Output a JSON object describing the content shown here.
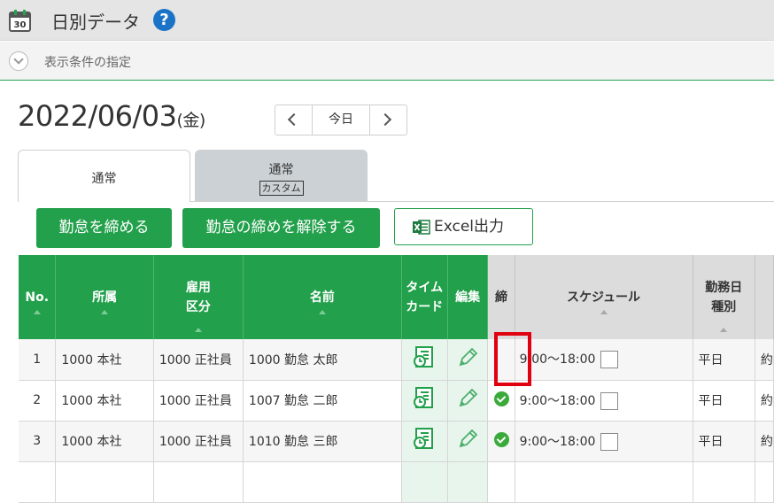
{
  "header": {
    "title": "日別データ",
    "calendar_day": "30",
    "help_symbol": "?"
  },
  "conditions": {
    "label": "表示条件の指定"
  },
  "date_nav": {
    "date": "2022/06/03",
    "weekday": "(金)",
    "today_label": "今日"
  },
  "tabs": [
    {
      "label": "通常",
      "sub": ""
    },
    {
      "label": "通常",
      "sub": "カスタム"
    }
  ],
  "actions": {
    "close_label": "勤怠を締める",
    "unclose_label": "勤怠の締めを解除する",
    "excel_label": "Excel出力"
  },
  "table": {
    "headers": {
      "no": "No.",
      "dept": "所属",
      "emp_type_1": "雇用",
      "emp_type_2": "区分",
      "name": "名前",
      "timecard_1": "タイム",
      "timecard_2": "カード",
      "edit": "編集",
      "close": "締",
      "schedule": "スケジュール",
      "daytype_1": "勤務日",
      "daytype_2": "種別"
    },
    "rows": [
      {
        "no": "1",
        "dept": "1000 本社",
        "emp_type": "1000 正社員",
        "name": "1000 勤怠 太郎",
        "closed": false,
        "schedule": "9:00～18:00",
        "day_type": "平日"
      },
      {
        "no": "2",
        "dept": "1000 本社",
        "emp_type": "1000 正社員",
        "name": "1007 勤怠 二郎",
        "closed": true,
        "schedule": "9:00～18:00",
        "day_type": "平日"
      },
      {
        "no": "3",
        "dept": "1000 本社",
        "emp_type": "1000 正社員",
        "name": "1010 勤怠 三郎",
        "closed": true,
        "schedule": "9:00～18:00",
        "day_type": "平日"
      }
    ]
  },
  "colors": {
    "brand_green": "#22a04b",
    "highlight_red": "#e0000f",
    "help_blue": "#1a73c6"
  }
}
